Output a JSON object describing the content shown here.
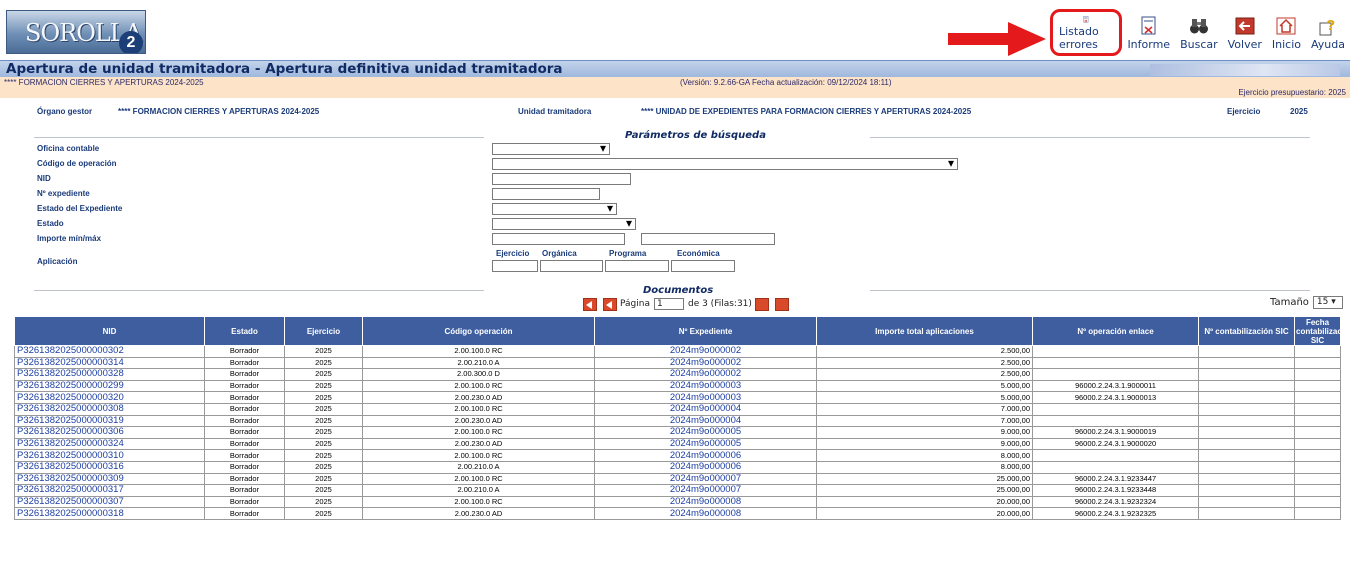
{
  "app": {
    "logo_text": "SOROLLA",
    "logo_suffix": "2"
  },
  "toolbar": [
    {
      "label": "Listado errores",
      "icon": "error-list-icon",
      "highlighted": true
    },
    {
      "label": "Informe",
      "icon": "report-icon",
      "highlighted": false
    },
    {
      "label": "Buscar",
      "icon": "binoculars-icon",
      "highlighted": false
    },
    {
      "label": "Volver",
      "icon": "back-arrow-icon",
      "highlighted": false
    },
    {
      "label": "Inicio",
      "icon": "home-icon",
      "highlighted": false
    },
    {
      "label": "Ayuda",
      "icon": "help-icon",
      "highlighted": false
    }
  ],
  "page": {
    "title": "Apertura de unidad tramitadora - Apertura definitiva unidad tramitadora",
    "context": "**** FORMACION CIERRES Y APERTURAS 2024-2025",
    "version": "(Versión: 9.2.66-GA Fecha actualización: 09/12/2024 18:11)",
    "budget_year": "Ejercicio presupuestario: 2025"
  },
  "header": {
    "organo_label": "Órgano gestor",
    "organo_value": "**** FORMACION CIERRES Y APERTURAS 2024-2025",
    "unidad_label": "Unidad tramitadora",
    "unidad_value": "**** UNIDAD DE EXPEDIENTES PARA FORMACION CIERRES Y APERTURAS 2024-2025",
    "ejercicio_label": "Ejercicio",
    "ejercicio_value": "2025"
  },
  "search": {
    "section_title": "Parámetros de búsqueda",
    "labels": {
      "oficina": "Oficina contable",
      "codigo": "Código de operación",
      "nid": "NID",
      "expediente": "Nº expediente",
      "estado_exp": "Estado del Expediente",
      "estado": "Estado",
      "importe": "Importe mín/máx",
      "aplicacion": "Aplicación"
    },
    "aplicacion_sublabels": [
      "Ejercicio",
      "Orgánica",
      "Programa",
      "Económica"
    ]
  },
  "documents": {
    "section_title": "Documentos",
    "pager": {
      "page_label": "Página",
      "page_value": "1",
      "of_label": "de 3 (Filas:31)"
    },
    "size_label": "Tamaño",
    "size_value": "15",
    "columns": [
      "NID",
      "Estado",
      "Ejercicio",
      "Código operación",
      "Nº Expediente",
      "Importe total aplicaciones",
      "Nº operación enlace",
      "Nº contabilización SIC",
      "Fecha contabilización SIC"
    ],
    "rows": [
      [
        "P3261382025000000302",
        "Borrador",
        "2025",
        "2.00.100.0 RC",
        "2024m9o000002",
        "2.500,00",
        "",
        "",
        ""
      ],
      [
        "P3261382025000000314",
        "Borrador",
        "2025",
        "2.00.210.0 A",
        "2024m9o000002",
        "2.500,00",
        "",
        "",
        ""
      ],
      [
        "P3261382025000000328",
        "Borrador",
        "2025",
        "2.00.300.0 D",
        "2024m9o000002",
        "2.500,00",
        "",
        "",
        ""
      ],
      [
        "P3261382025000000299",
        "Borrador",
        "2025",
        "2.00.100.0 RC",
        "2024m9o000003",
        "5.000,00",
        "96000.2.24.3.1.9000011",
        "",
        ""
      ],
      [
        "P3261382025000000320",
        "Borrador",
        "2025",
        "2.00.230.0 AD",
        "2024m9o000003",
        "5.000,00",
        "96000.2.24.3.1.9000013",
        "",
        ""
      ],
      [
        "P3261382025000000308",
        "Borrador",
        "2025",
        "2.00.100.0 RC",
        "2024m9o000004",
        "7.000,00",
        "",
        "",
        ""
      ],
      [
        "P3261382025000000319",
        "Borrador",
        "2025",
        "2.00.230.0 AD",
        "2024m9o000004",
        "7.000,00",
        "",
        "",
        ""
      ],
      [
        "P3261382025000000306",
        "Borrador",
        "2025",
        "2.00.100.0 RC",
        "2024m9o000005",
        "9.000,00",
        "96000.2.24.3.1.9000019",
        "",
        ""
      ],
      [
        "P3261382025000000324",
        "Borrador",
        "2025",
        "2.00.230.0 AD",
        "2024m9o000005",
        "9.000,00",
        "96000.2.24.3.1.9000020",
        "",
        ""
      ],
      [
        "P3261382025000000310",
        "Borrador",
        "2025",
        "2.00.100.0 RC",
        "2024m9o000006",
        "8.000,00",
        "",
        "",
        ""
      ],
      [
        "P3261382025000000316",
        "Borrador",
        "2025",
        "2.00.210.0 A",
        "2024m9o000006",
        "8.000,00",
        "",
        "",
        ""
      ],
      [
        "P3261382025000000309",
        "Borrador",
        "2025",
        "2.00.100.0 RC",
        "2024m9o000007",
        "25.000,00",
        "96000.2.24.3.1.9233447",
        "",
        ""
      ],
      [
        "P3261382025000000317",
        "Borrador",
        "2025",
        "2.00.210.0 A",
        "2024m9o000007",
        "25.000,00",
        "96000.2.24.3.1.9233448",
        "",
        ""
      ],
      [
        "P3261382025000000307",
        "Borrador",
        "2025",
        "2.00.100.0 RC",
        "2024m9o000008",
        "20.000,00",
        "96000.2.24.3.1.9232324",
        "",
        ""
      ],
      [
        "P3261382025000000318",
        "Borrador",
        "2025",
        "2.00.230.0 AD",
        "2024m9o000008",
        "20.000,00",
        "96000.2.24.3.1.9232325",
        "",
        ""
      ]
    ]
  },
  "colors": {
    "header_blue": "#3e5e9f",
    "info_orange": "#fde3c7",
    "highlight_red": "#e3191b",
    "link_blue": "#1b3ea3"
  }
}
